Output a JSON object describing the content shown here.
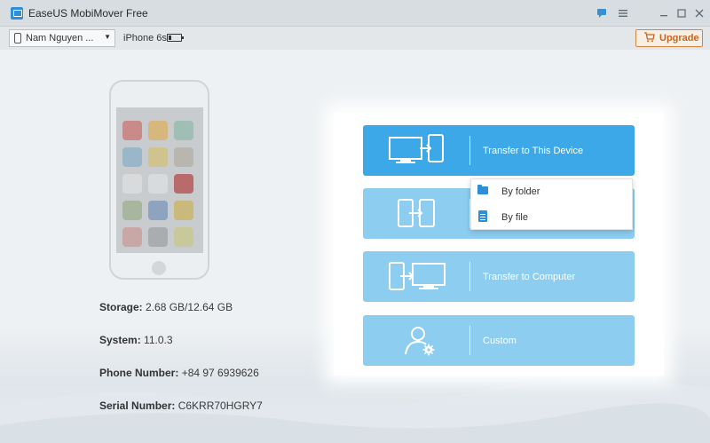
{
  "window": {
    "title": "EaseUS MobiMover Free"
  },
  "toolbar": {
    "device_name": "Nam Nguyen ...",
    "device_model": "iPhone 6s",
    "upgrade_label": "Upgrade"
  },
  "device_info": {
    "storage_label": "Storage:",
    "storage_value": "2.68 GB/12.64 GB",
    "system_label": "System:",
    "system_value": "11.0.3",
    "phone_label": "Phone Number:",
    "phone_value": "+84 97 6939626",
    "serial_label": "Serial Number:",
    "serial_value": "C6KRR70HGRY7"
  },
  "actions": {
    "transfer_to_device": "Transfer to This Device",
    "transfer_to_computer": "Transfer to Computer",
    "custom": "Custom"
  },
  "popup": {
    "by_folder": "By folder",
    "by_file": "By file"
  },
  "icons": {
    "app": "easeus-logo-icon",
    "feedback": "feedback-icon",
    "menu": "menu-icon",
    "minimize": "minimize-icon",
    "maximize": "maximize-icon",
    "close": "close-icon",
    "cart": "cart-icon",
    "battery": "battery-icon",
    "folder": "folder-icon",
    "file": "file-icon"
  },
  "colors": {
    "primary_button": "#3ca8e8",
    "light_button": "#8ccdf0",
    "upgrade": "#d4843c",
    "accent_blue": "#2f8fd6"
  }
}
